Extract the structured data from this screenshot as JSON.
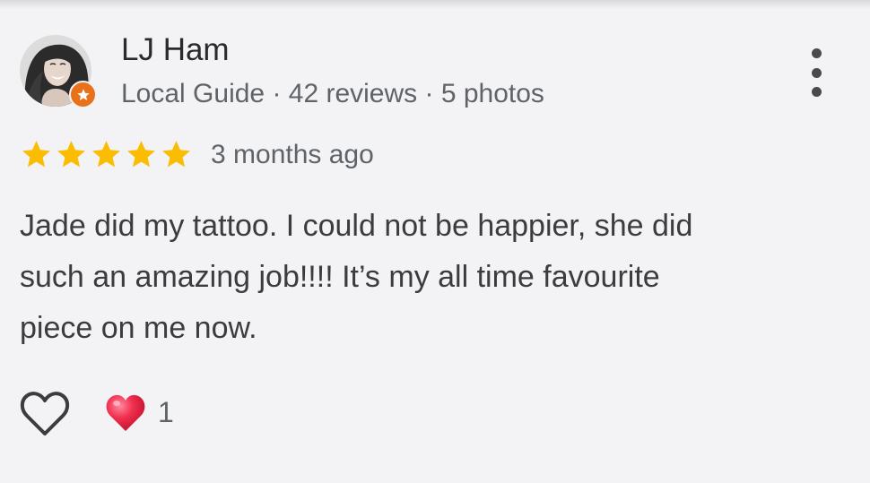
{
  "review": {
    "author_name": "LJ Ham",
    "author_meta": "Local Guide · 42 reviews · 5 photos",
    "rating": 5,
    "rating_max": 5,
    "time_ago": "3 months ago",
    "text_lines": [
      "Jade did my tattoo. I could not be happier, she did",
      "such an amazing job!!!! It’s my all time favourite",
      "piece on me now."
    ],
    "reaction_count": "1"
  },
  "icons": {
    "avatar": "profile-photo",
    "badge": "local-guide-star-icon",
    "menu": "more-vert-icon",
    "star": "star-icon",
    "like": "heart-outline-icon",
    "reaction": "red-heart-emoji-icon"
  },
  "colors": {
    "background": "#f3f3f5",
    "star": "#fbbc04",
    "badge": "#e8711a",
    "text": "#3c3c3f",
    "secondary_text": "#5f6368",
    "reaction_heart": "#f0304f"
  }
}
